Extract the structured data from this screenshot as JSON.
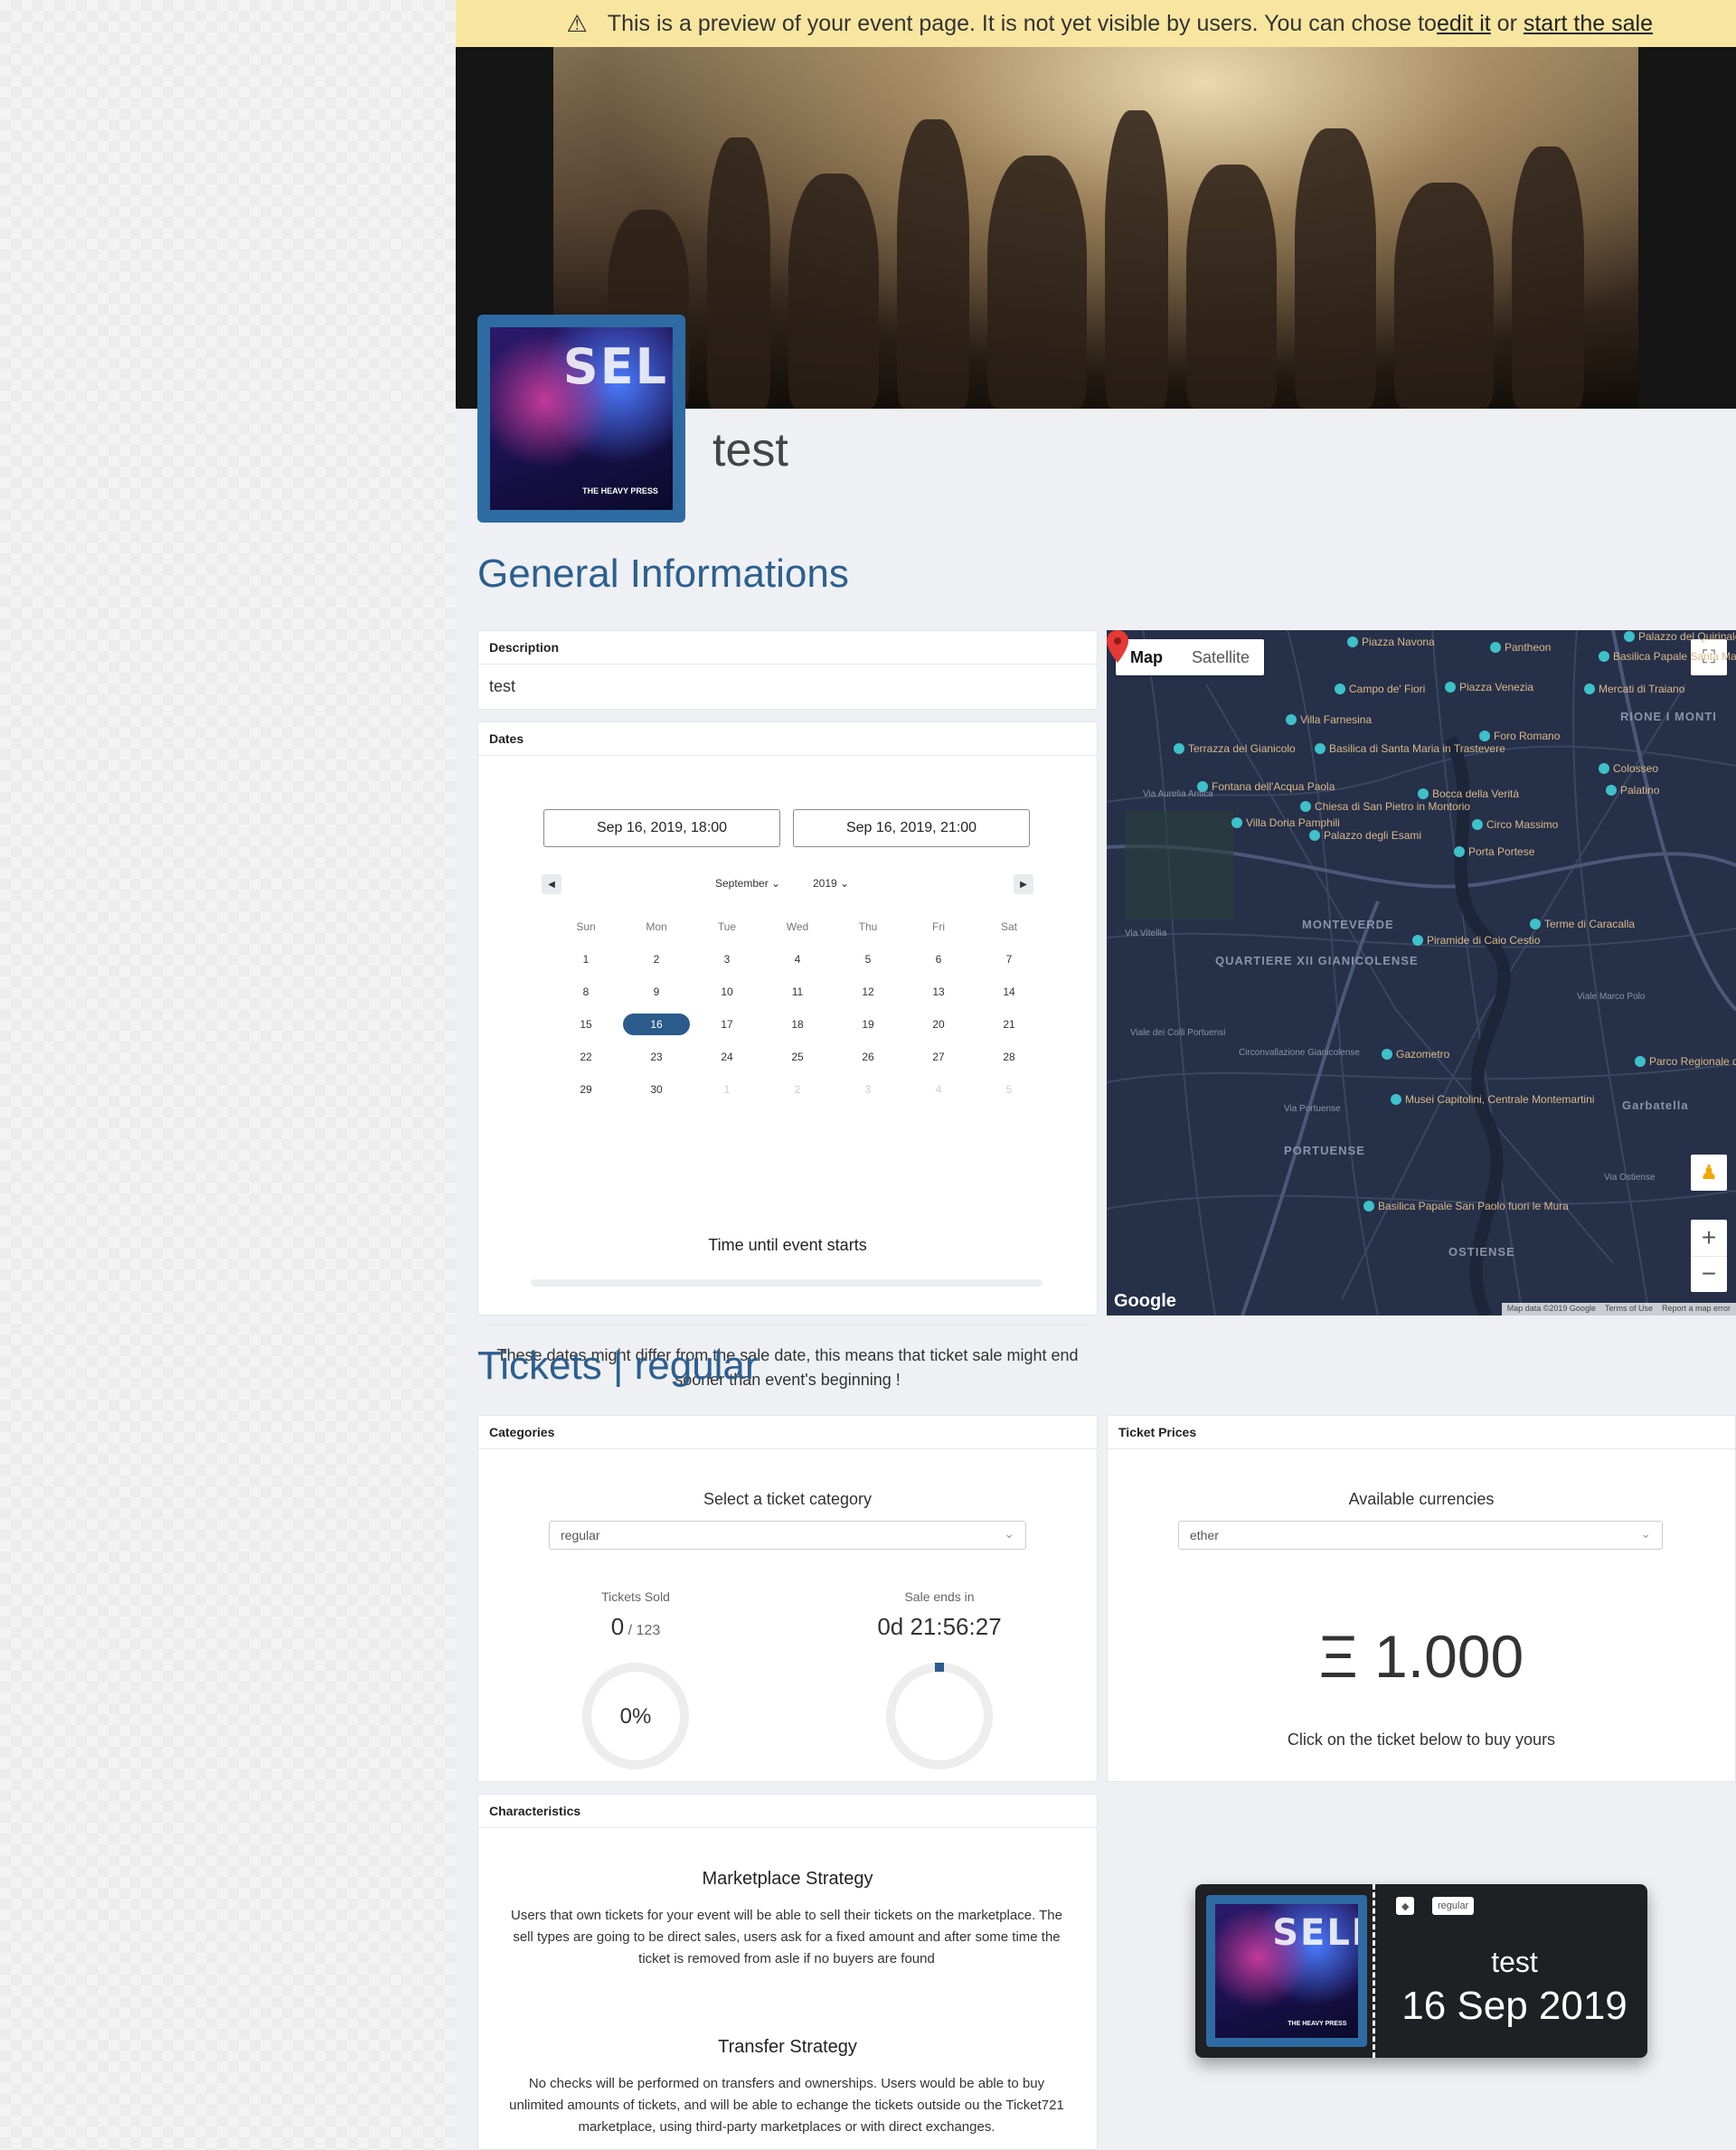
{
  "banner": {
    "text": "This is a preview of your event page. It is not yet visible by users. You can chose to ",
    "edit_link": "edit it",
    "or_text": " or ",
    "sale_link": "start the sale"
  },
  "event": {
    "title": "test",
    "avatar_text": "SELFI",
    "avatar_sub": "THE HEAVY PRESS"
  },
  "general": {
    "title": "General Informations",
    "description_label": "Description",
    "description": "test",
    "dates_label": "Dates",
    "start_date": "Sep 16, 2019, 18:00",
    "end_date": "Sep 16, 2019, 21:00",
    "calendar": {
      "month": "September",
      "year": "2019",
      "weekdays": [
        "Sun",
        "Mon",
        "Tue",
        "Wed",
        "Thu",
        "Fri",
        "Sat"
      ],
      "weeks": [
        [
          "1",
          "2",
          "3",
          "4",
          "5",
          "6",
          "7"
        ],
        [
          "8",
          "9",
          "10",
          "11",
          "12",
          "13",
          "14"
        ],
        [
          "15",
          "16",
          "17",
          "18",
          "19",
          "20",
          "21"
        ],
        [
          "22",
          "23",
          "24",
          "25",
          "26",
          "27",
          "28"
        ],
        [
          "29",
          "30",
          "1",
          "2",
          "3",
          "4",
          "5"
        ]
      ],
      "selected": "16"
    },
    "countdown_label": "Time until event starts",
    "dates_note": "These dates might differ from the sale date, this means that ticket sale might end sooner than event's beginning !"
  },
  "map": {
    "toggle_map": "Map",
    "toggle_satellite": "Satellite",
    "google": "Google",
    "footer": [
      "Map data ©2019 Google",
      "Terms of Use",
      "Report a map error"
    ],
    "places": [
      "Piazza Navona",
      "Pantheon",
      "Palazzo del Quirinale",
      "Basilica Papale Santa Maria Maggiore",
      "Campo de' Fiori",
      "Piazza Venezia",
      "Mercati di Traiano",
      "RIONE I MONTI",
      "Villa Farnesina",
      "Foro Romano",
      "Terrazza del Gianicolo",
      "Basilica di Santa Maria in Trastevere",
      "Colosseo",
      "Palatino",
      "Fontana dell'Acqua Paola",
      "Bocca della Verità",
      "Chiesa di San Pietro in Montorio",
      "Villa Doria Pamphili",
      "Circo Massimo",
      "Palazzo degli Esami",
      "Porta Portese",
      "MONTEVERDE",
      "Terme di Caracalla",
      "Piramide di Caio Cestio",
      "QUARTIERE XII GIANICOLENSE",
      "Gazometro",
      "Musei Capitolini, Centrale Montemartini",
      "Garbatella",
      "PORTUENSE",
      "Basilica Papale San Paolo fuori le Mura",
      "OSTIENSE",
      "Parco Regionale dell'Appia Antica",
      "Via Aurelia Antica",
      "Via Vitellia",
      "Viale dei Colli Portuensi",
      "Circonvallazione Gianicolense",
      "Via Portuense",
      "Viale Marco Polo",
      "Via Ostiense"
    ]
  },
  "tickets": {
    "title": "Tickets | regular",
    "categories_label": "Categories",
    "select_category": "Select a ticket category",
    "category_value": "regular",
    "sold_label": "Tickets Sold",
    "sold_value": "0",
    "sold_total": " / 123",
    "sold_percent": "0%",
    "sold_fraction": 0,
    "sale_ends_label": "Sale ends in",
    "sale_ends_value": "0d 21:56:27",
    "prices_label": "Ticket Prices",
    "currencies_label": "Available currencies",
    "currency_value": "ether",
    "price": "Ξ 1.000",
    "buy_hint": "Click on the ticket below to buy yours"
  },
  "characteristics": {
    "label": "Characteristics",
    "marketplace_title": "Marketplace Strategy",
    "marketplace_text": "Users that own tickets for your event will be able to sell their tickets on the marketplace. The sell types are going to be direct sales, users ask for a fixed amount and after some time the ticket is removed from asle if no buyers are found",
    "transfer_title": "Transfer Strategy",
    "transfer_text": "No checks will be performed on transfers and ownerships. Users would be able to buy unlimited amounts of tickets, and will be able to echange the tickets outside ou the Ticket721 marketplace, using third-party marketplaces or with direct exchanges."
  },
  "ticket": {
    "badge_icon": "ether",
    "badge_category": "regular",
    "name": "test",
    "date": "16 Sep 2019"
  },
  "colors": {
    "accent": "#2d5f8f",
    "banner": "#f8e6a0",
    "map_bg": "#263049",
    "ticket_bg": "#1f2024"
  }
}
